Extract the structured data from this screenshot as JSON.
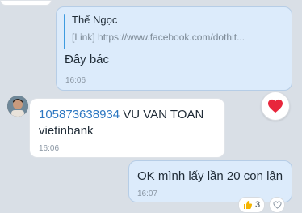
{
  "messages": [
    {
      "quote": {
        "sender": "Thế Ngọc",
        "link_text": "[Link] https://www.facebook.com/dothit..."
      },
      "text": "Đây bác",
      "time": "16:06"
    },
    {
      "phone": "105873638934",
      "text_after_phone": " VU VAN TOAN vietinbank",
      "time": "16:06"
    },
    {
      "text": "OK mình lấy lần 20 con lận",
      "time": "16:07",
      "reaction_count": "3"
    }
  ],
  "icons": {
    "heart_reaction": "heart-icon",
    "like_reaction": "thumbs-up-icon",
    "add_reaction": "heart-outline-icon",
    "avatar": "user-avatar"
  },
  "colors": {
    "outgoing_bubble": "#dcebfb",
    "incoming_bubble": "#ffffff",
    "heart": "#e8263c",
    "link_phone": "#2e78c2",
    "quote_bar": "#3d9be0"
  }
}
